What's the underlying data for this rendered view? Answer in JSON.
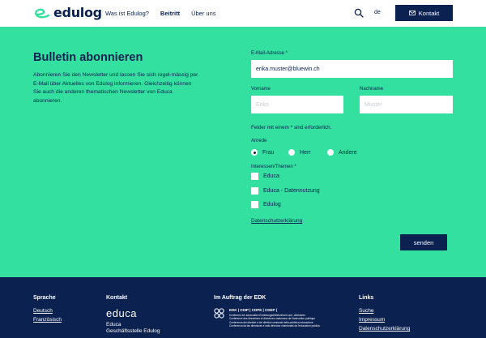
{
  "header": {
    "logo_text": "edulog",
    "nav": [
      "Was ist Edulog?",
      "Beitritt",
      "Über uns"
    ],
    "active_nav": "Beitritt",
    "language": "de",
    "contact_button": "Kontakt"
  },
  "form": {
    "title": "Bulletin abonnieren",
    "intro": "Abonnieren Sie den Newsletter und lassen Sie sich regel-mässig per E-Mail über Aktuelles von Edulog informieren. Gleichzeitig können Sie auch die anderen thematischen Newsletter von Educa abonnieren.",
    "email_label": "E-Mail-Adresse *",
    "email_value": "erika.muster@bluewin.ch",
    "firstname_label": "Vorname",
    "firstname_placeholder": "Erika",
    "lastname_label": "Nachname",
    "lastname_placeholder": "Muster",
    "required_note": "Felder mit einem * sind erforderlich.",
    "salutation_label": "Anrede",
    "salutations": [
      "Frau",
      "Herr",
      "Andere"
    ],
    "selected_salutation": "Frau",
    "interests_label": "Interessen/Themen *",
    "interests": [
      "Educa",
      "Educa - Datennutzung",
      "Edulog"
    ],
    "privacy_link": "Datenschutzerklärung",
    "submit": "senden"
  },
  "footer": {
    "language_head": "Sprache",
    "languages": [
      "Deutsch",
      "Französisch"
    ],
    "contact_head": "Kontakt",
    "educa_logo": "educa",
    "contact_lines": [
      "Educa",
      "Geschäftsstelle Edulog"
    ],
    "edk_head": "Im Auftrag der EDK",
    "edk_abbrev": "EDK | CDIP | CDPE | CDEP |",
    "edk_lines": [
      "Konferenz der kantonalen Erziehungsdirektorinnen und -direktoren",
      "Conférence des directrices et directeurs cantonaux de l'instruction publique",
      "Conferenza dei direttori e dei direttori cantonali della pubblica educazione",
      "Conferenza da las directuras e dals directurs chantunals da l'educaziun publica"
    ],
    "links_head": "Links",
    "links": [
      "Suche",
      "Impressum",
      "Datenschutzerklärung"
    ]
  },
  "colors": {
    "brand_navy": "#0b2150",
    "brand_green": "#34e09f"
  }
}
